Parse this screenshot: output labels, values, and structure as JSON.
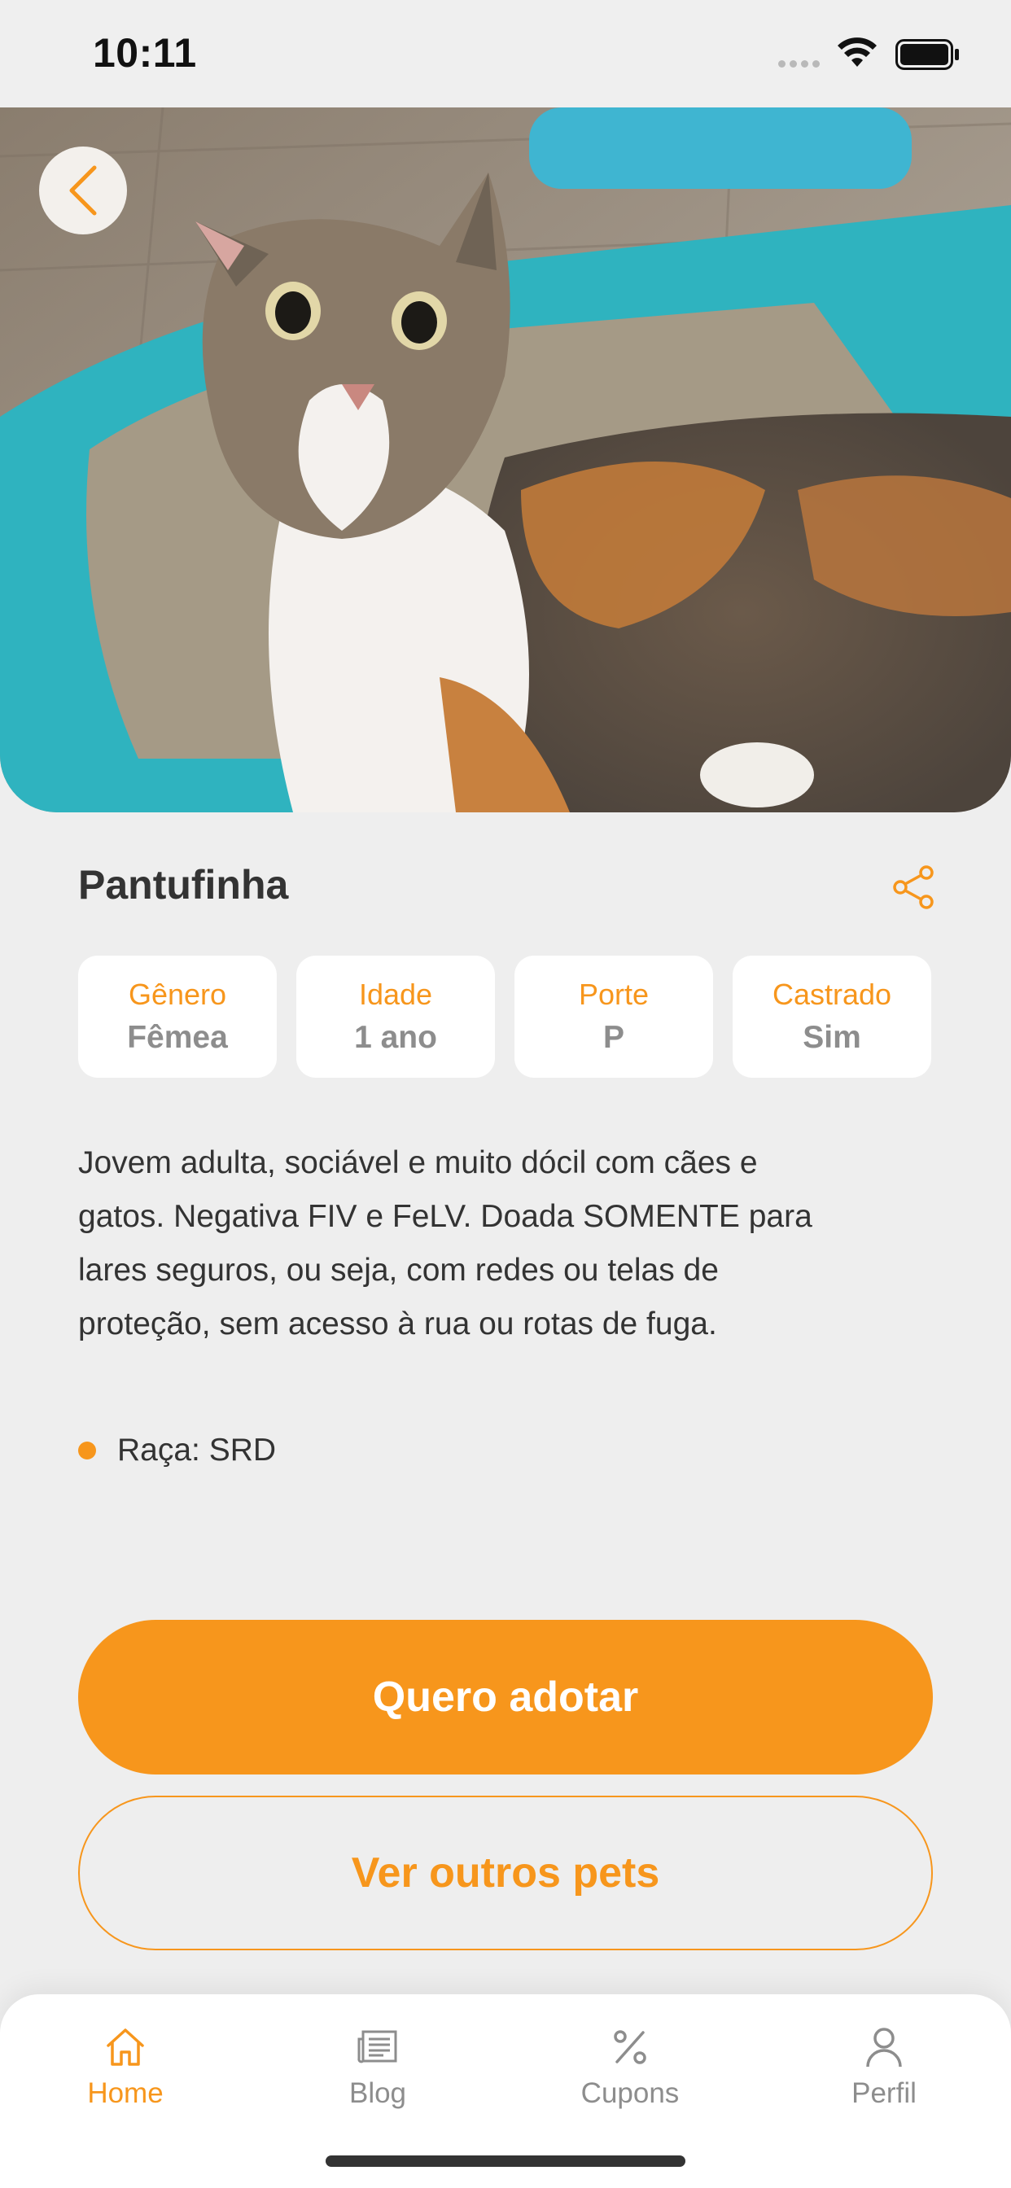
{
  "status_bar": {
    "time": "10:11"
  },
  "pet": {
    "name": "Pantufinha",
    "attributes": [
      {
        "label": "Gênero",
        "value": "Fêmea"
      },
      {
        "label": "Idade",
        "value": "1 ano"
      },
      {
        "label": "Porte",
        "value": "P"
      },
      {
        "label": "Castrado",
        "value": "Sim"
      }
    ],
    "description": "Jovem adulta, sociável e muito  dócil com cães e\ngatos. Negativa FIV e FeLV. Doada SOMENTE para\nlares seguros,  ou seja,  com redes ou telas de\nproteção,  sem acesso à rua ou rotas de fuga.",
    "breed": "Raça: SRD"
  },
  "actions": {
    "adopt": "Quero adotar",
    "other_pets": "Ver outros pets"
  },
  "tabs": [
    {
      "label": "Home",
      "icon": "home-icon",
      "active": true
    },
    {
      "label": "Blog",
      "icon": "newspaper-icon",
      "active": false
    },
    {
      "label": "Cupons",
      "icon": "percent-icon",
      "active": false
    },
    {
      "label": "Perfil",
      "icon": "user-icon",
      "active": false
    }
  ],
  "colors": {
    "accent": "#f7961c",
    "background": "#eeeeee",
    "card": "#ffffff",
    "muted": "#8d8d8d"
  }
}
